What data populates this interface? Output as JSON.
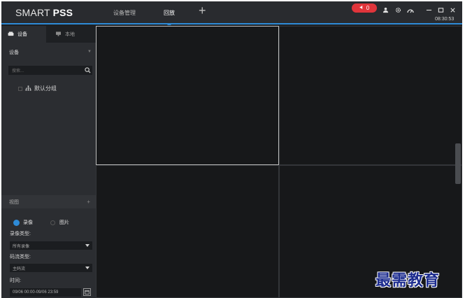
{
  "app": {
    "logo_light": "SMART",
    "logo_bold": "PSS",
    "tabs": [
      {
        "label": "设备管理"
      },
      {
        "label": "回放"
      }
    ],
    "add_tab": "+",
    "alarm_count": "0",
    "clock": "08:30:53"
  },
  "sidebar": {
    "tabs": [
      {
        "label": "设备"
      },
      {
        "label": "本地"
      }
    ],
    "device_section": "设备",
    "search_placeholder": "搜索...",
    "tree": [
      {
        "label": "默认分组"
      }
    ],
    "view_section": "视图",
    "record_option": "录像",
    "image_option": "图片",
    "record_type_label": "录像类型:",
    "record_type_value": "所有录像",
    "stream_type_label": "码流类型:",
    "stream_type_value": "主码流",
    "time_label": "时间:",
    "time_value": "09/06 00:00-09/06 23:59"
  },
  "watermark": "最需教育",
  "colors": {
    "accent": "#2e8bd7",
    "alarm": "#e0353b",
    "background": "#17181a",
    "sidebar": "#2b2d31"
  }
}
